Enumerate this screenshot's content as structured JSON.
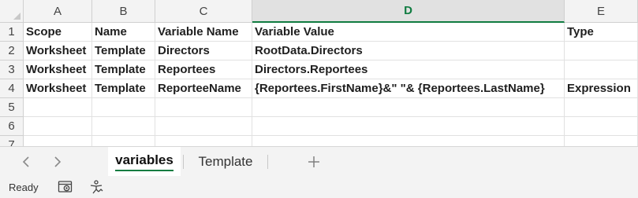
{
  "columns": [
    "A",
    "B",
    "C",
    "D",
    "E"
  ],
  "selected_column": "D",
  "rows": [
    {
      "num": "1",
      "cells": [
        "Scope",
        "Name",
        "Variable Name",
        "Variable Value",
        "Type"
      ]
    },
    {
      "num": "2",
      "cells": [
        "Worksheet",
        "Template",
        "Directors",
        "RootData.Directors",
        ""
      ]
    },
    {
      "num": "3",
      "cells": [
        "Worksheet",
        "Template",
        "Reportees",
        "Directors.Reportees",
        ""
      ]
    },
    {
      "num": "4",
      "cells": [
        "Worksheet",
        "Template",
        "ReporteeName",
        "{Reportees.FirstName}&\" \"& {Reportees.LastName}",
        "Expression"
      ]
    },
    {
      "num": "5",
      "cells": [
        "",
        "",
        "",
        "",
        ""
      ]
    },
    {
      "num": "6",
      "cells": [
        "",
        "",
        "",
        "",
        ""
      ]
    },
    {
      "num": "7",
      "cells": [
        "",
        "",
        "",
        "",
        ""
      ]
    }
  ],
  "tabs": {
    "prev_icon": "chevron-left-icon",
    "next_icon": "chevron-right-icon",
    "sheets": [
      "variables",
      "Template"
    ],
    "active": "variables",
    "add_icon": "plus-icon"
  },
  "status": {
    "text": "Ready",
    "icons": [
      "accessibility-check-icon",
      "macro-recorder-icon"
    ]
  },
  "colors": {
    "accent": "#107c41",
    "header_bg": "#f3f3f3",
    "gridline": "#e1e1e1"
  }
}
